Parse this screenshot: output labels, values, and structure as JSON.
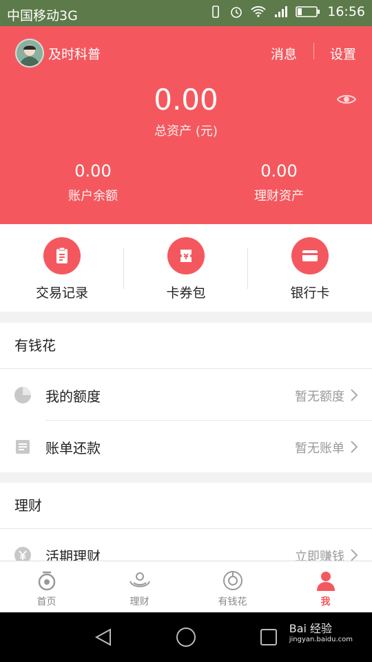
{
  "status_bar": {
    "carrier": "中国移动3G",
    "time": "16:56"
  },
  "header": {
    "username": "及时科普",
    "messages": "消息",
    "settings": "设置",
    "total_assets_value": "0.00",
    "total_assets_label": "总资产 (元)",
    "balance_value": "0.00",
    "balance_label": "账户余额",
    "finance_value": "0.00",
    "finance_label": "理财资产",
    "accent": "#f4585e"
  },
  "quick_actions": [
    {
      "label": "交易记录",
      "icon": "clipboard-icon"
    },
    {
      "label": "卡券包",
      "icon": "ticket-icon"
    },
    {
      "label": "银行卡",
      "icon": "card-icon"
    }
  ],
  "sections": {
    "credit": {
      "title": "有钱花",
      "rows": [
        {
          "label": "我的额度",
          "value": "暂无额度",
          "icon": "pie-chart-icon"
        },
        {
          "label": "账单还款",
          "value": "暂无账单",
          "icon": "bill-icon"
        }
      ]
    },
    "wealth": {
      "title": "理财",
      "rows": [
        {
          "label": "活期理财",
          "value": "立即赚钱",
          "icon": "yen-icon"
        }
      ]
    }
  },
  "tabs": [
    {
      "label": "首页",
      "icon": "home-icon"
    },
    {
      "label": "理财",
      "icon": "finance-icon"
    },
    {
      "label": "有钱花",
      "icon": "credit-icon"
    },
    {
      "label": "我",
      "icon": "person-icon"
    }
  ],
  "watermark": {
    "brand": "Bai 经验",
    "url": "jingyan.baidu.com"
  }
}
